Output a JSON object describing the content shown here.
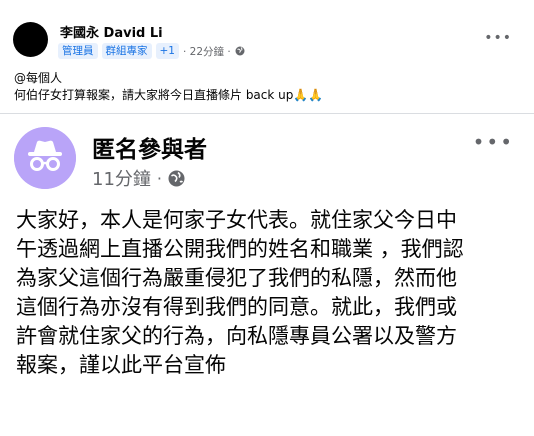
{
  "outer_post": {
    "author": "李國永 David Li",
    "badges": [
      "管理員",
      "群組專家"
    ],
    "plus_count": "+1",
    "time": "· 22分鐘 ·",
    "caption_lines": [
      "@每個人",
      "何伯仔女打算報案，請大家將今日直播條片 back up🙏🙏"
    ],
    "more_label": "•••"
  },
  "inner_post": {
    "author": "匿名參與者",
    "time": "11分鐘",
    "dot": "·",
    "more_label": "•••",
    "body_lines": [
      "大家好，本人是何家子女代表。就住家父今日中",
      "午透過網上直播公開我們的姓名和職業 ，我們認",
      "為家父這個行為嚴重侵犯了我們的私隱，然而他",
      "這個行為亦沒有得到我們的同意。就此，我們或",
      "許會就住家父的行為，向私隱專員公署以及警方",
      "報案，謹以此平台宣佈"
    ]
  },
  "colors": {
    "accent": "#1b74e4",
    "anon_avatar": "#b9a4f8",
    "secondary_text": "#65676b"
  },
  "icons": {
    "outer_avatar": "avatar",
    "privacy": "globe-icon",
    "anon": "incognito-icon",
    "more": "more-horizontal-icon"
  }
}
